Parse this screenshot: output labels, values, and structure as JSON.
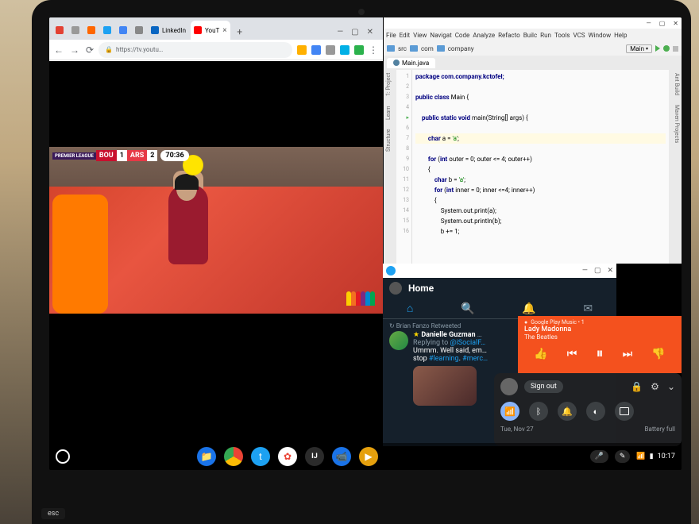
{
  "chrome": {
    "tabs": [
      {
        "icon_color": "#e34133"
      },
      {
        "icon_color": "#999"
      },
      {
        "icon_color": "#ff6600"
      },
      {
        "icon_color": "#1da1f2"
      },
      {
        "icon_color": "#4285f4"
      },
      {
        "icon_color": "#888"
      },
      {
        "icon_color": "#0a66c2",
        "label": "LinkedIn"
      },
      {
        "icon_color": "#ff0000",
        "label": "YouT",
        "active": true
      }
    ],
    "new_tab_glyph": "+",
    "win_controls": {
      "min": "—",
      "max": "▢",
      "close": "✕"
    },
    "nav": {
      "back": "←",
      "fwd": "→",
      "reload": "⟳"
    },
    "lock_glyph": "🔒",
    "url": "https://tv.youtu…",
    "ext_colors": [
      "#ffb000",
      "#4285f4",
      "#999",
      "#00b0e6",
      "#2bb24c",
      "#666"
    ],
    "menu_glyph": "⋮"
  },
  "match": {
    "league": "PREMIER LEAGUE",
    "team_a": "BOU",
    "score_a": "1",
    "team_b": "ARS",
    "score_b": "2",
    "time": "70:36",
    "broadcaster": "NBC"
  },
  "ide": {
    "win_controls": {
      "min": "—",
      "max": "▢",
      "close": "✕"
    },
    "menu": [
      "File",
      "Edit",
      "View",
      "Navigat",
      "Code",
      "Analyze",
      "Refacto",
      "Builc",
      "Run",
      "Tools",
      "VCS",
      "Window",
      "Help"
    ],
    "breadcrumbs": [
      "src",
      "com",
      "company"
    ],
    "run_config": "Main",
    "run_dropdown_glyph": "▾",
    "tab_file": "Main.java",
    "side_left": [
      "1: Project",
      "Learn",
      "Structure"
    ],
    "side_right_top": "Ant Build",
    "side_right_bottom": "Maven Projects",
    "gutter": [
      "1",
      "2",
      "3",
      "4",
      "5",
      "6",
      "7",
      "8",
      "9",
      "10",
      "11",
      "12",
      "13",
      "14",
      "15",
      "16"
    ],
    "code": {
      "l1": "package com.company.kctofel;",
      "l2": "",
      "l3_a": "public class",
      "l3_b": " Main {",
      "l4": "",
      "l5_a": "    public static void",
      "l5_b": " main(String[] args) {",
      "l6": "",
      "l7_a": "        char",
      "l7_b": " a = ",
      "l7_c": "'a'",
      "l7_d": ";",
      "l8": "",
      "l9_a": "        for",
      "l9_b": " (",
      "l9_c": "int",
      "l9_d": " outer = 0; outer <= 4; outer++)",
      "l10": "        {",
      "l11_a": "            char",
      "l11_b": " b = ",
      "l11_c": "'a'",
      "l11_d": ";",
      "l12_a": "            for",
      "l12_b": " (",
      "l12_c": "int",
      "l12_d": " inner = 0; inner <=4; inner++)",
      "l13": "            {",
      "l14": "                System.out.print(a);",
      "l15": "                System.out.println(b);",
      "l16": "                b += 1;"
    }
  },
  "twitter": {
    "window_title": "",
    "win_controls": {
      "min": "—",
      "max": "▢",
      "close": "✕"
    },
    "header": "Home",
    "tabs_glyphs": {
      "home": "⌂",
      "search": "🔍",
      "bell": "🔔",
      "mail": "✉"
    },
    "retweet_label": "Brian Fanzo Retweeted",
    "retweet_glyph": "↻",
    "star_glyph": "★",
    "name": "Danielle Guzman",
    "handle_suffix": "…",
    "reply_prefix": "Replying to ",
    "reply_to": "@iSocialF…",
    "text_part1": "Ummm. Well said, em…",
    "text_part2": "stop ",
    "hash1": "#learning",
    "text_part3": ". ",
    "hash2": "#merc…"
  },
  "music": {
    "source": "Google Play Music • 1",
    "circle_glyph": "●",
    "title": "Lady Madonna",
    "artist": "The Beatles",
    "controls": {
      "thumbs_up": "👍",
      "prev": "⏮",
      "pause": "⏸",
      "next": "⏭",
      "thumbs_down": "👎"
    }
  },
  "qs": {
    "signout": "Sign out",
    "lock_glyph": "🔒",
    "gear_glyph": "⚙",
    "chevron_glyph": "⌄",
    "toggles": {
      "wifi": "📶",
      "bt": "ᛒ",
      "notif": "🔔",
      "night": "◐",
      "cast": "▣"
    },
    "date": "Tue, Nov 27",
    "battery": "Battery full"
  },
  "shelf": {
    "apps": [
      {
        "name": "files",
        "bg": "#1a73e8",
        "glyph": "📁"
      },
      {
        "name": "chrome",
        "bg": "#fff",
        "glyph": "◉"
      },
      {
        "name": "twitter",
        "bg": "#1da1f2",
        "glyph": "t"
      },
      {
        "name": "photos",
        "bg": "#fff",
        "glyph": "✿"
      },
      {
        "name": "intellij",
        "bg": "#2b2b2b",
        "glyph": "IJ"
      },
      {
        "name": "duo",
        "bg": "#1a73e8",
        "glyph": "📹"
      },
      {
        "name": "plex",
        "bg": "#e5a00d",
        "glyph": "▶"
      }
    ],
    "mic_glyph": "🎤",
    "pen_glyph": "✎",
    "wifi_glyph": "📶",
    "battery_glyph": "▮",
    "time": "10:17"
  },
  "kb_hint": "esc"
}
